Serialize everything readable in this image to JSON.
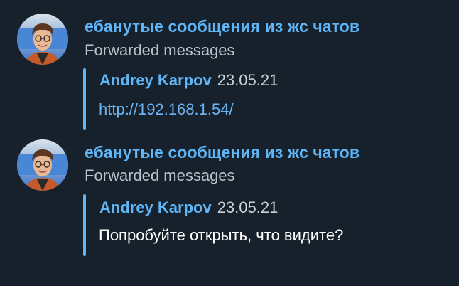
{
  "messages": [
    {
      "sender": "ебанутые сообщения из жс чатов",
      "forwarded_label": "Forwarded messages",
      "original_author": "Andrey Karpov",
      "original_date": "23.05.21",
      "text": "http://192.168.1.54/",
      "is_link": true,
      "avatar_icon": "user-photo-avatar"
    },
    {
      "sender": "ебанутые сообщения из жс чатов",
      "forwarded_label": "Forwarded messages",
      "original_author": "Andrey Karpov",
      "original_date": "23.05.21",
      "text": "Попробуйте открыть, что видите?",
      "is_link": false,
      "avatar_icon": "user-photo-avatar"
    }
  ],
  "colors": {
    "background": "#17212b",
    "accent": "#5eb5f7",
    "text": "#ffffff",
    "muted": "#b9c3cd"
  }
}
